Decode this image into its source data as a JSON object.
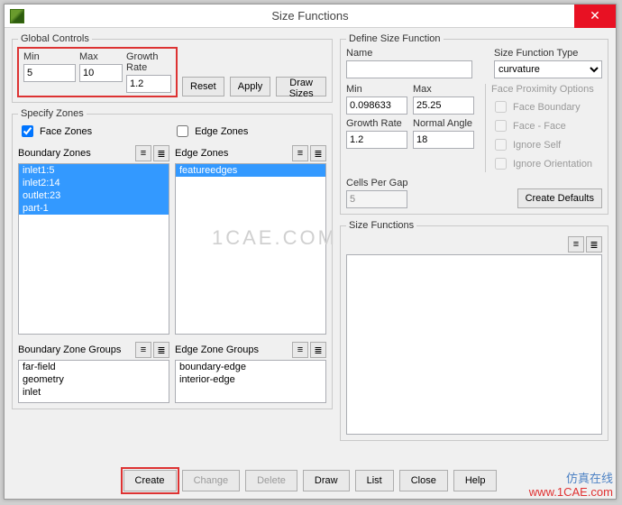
{
  "window": {
    "title": "Size Functions"
  },
  "legends": {
    "globalControls": "Global Controls",
    "specifyZones": "Specify Zones",
    "defineSizeFunction": "Define Size Function",
    "sizeFunctions": "Size Functions",
    "faceProximity": "Face Proximity Options"
  },
  "labels": {
    "min": "Min",
    "max": "Max",
    "growthRate": "Growth Rate",
    "faceZones": "Face Zones",
    "edgeZones": "Edge Zones",
    "boundaryZones": "Boundary Zones",
    "boundaryZoneGroups": "Boundary Zone Groups",
    "edgeZoneGroups": "Edge Zone Groups",
    "name": "Name",
    "sizeFunctionType": "Size Function Type",
    "defMin": "Min",
    "defMax": "Max",
    "normalAngle": "Normal Angle",
    "cellsPerGap": "Cells Per Gap",
    "faceBoundary": "Face Boundary",
    "faceFace": "Face - Face",
    "ignoreSelf": "Ignore Self",
    "ignoreOrientation": "Ignore Orientation"
  },
  "buttons": {
    "reset": "Reset",
    "apply": "Apply",
    "drawSizes": "Draw Sizes",
    "createDefaults": "Create Defaults",
    "create": "Create",
    "change": "Change",
    "delete": "Delete",
    "draw": "Draw",
    "list": "List",
    "close": "Close",
    "help": "Help"
  },
  "global": {
    "min": "5",
    "max": "10",
    "growthRate": "1.2"
  },
  "zones": {
    "faceZonesChecked": true,
    "edgeZonesChecked": false,
    "boundaryZones": [
      "inlet1:5",
      "inlet2:14",
      "outlet:23",
      "part-1"
    ],
    "boundaryZonesSelected": [
      0,
      1,
      2,
      3
    ],
    "edgeZones": [
      "featureedges"
    ],
    "edgeZonesSelected": [
      0
    ],
    "boundaryZoneGroups": [
      "far-field",
      "geometry",
      "inlet"
    ],
    "edgeZoneGroups": [
      "boundary-edge",
      "interior-edge"
    ]
  },
  "define": {
    "name": "",
    "type": "curvature",
    "min": "0.098633",
    "max": "25.25",
    "growthRate": "1.2",
    "normalAngle": "18",
    "cellsPerGap": "5"
  },
  "watermark": {
    "line1": "仿真在线",
    "line2": "www.1CAE.com",
    "center": "1CAE.COM"
  }
}
